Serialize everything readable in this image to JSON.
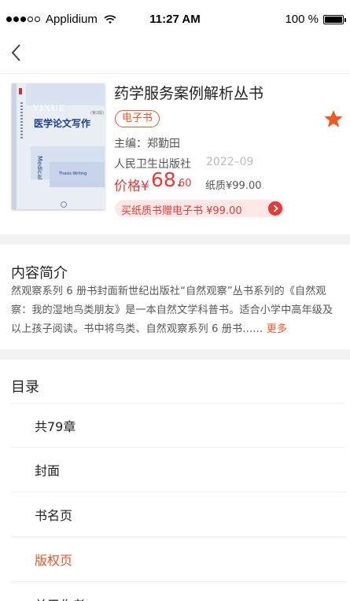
{
  "status_bar": {
    "carrier": "Applidium",
    "time": "11:27 AM",
    "battery": "100 %"
  },
  "nav": {
    "back_icon": "chevron-left-icon"
  },
  "book": {
    "cover": {
      "header_text": "YIXUE",
      "title": "医学论文写作",
      "edition": "(第2版)",
      "spine_text": "Medical",
      "subtitle": "Thesis Writing"
    },
    "title": "药学服务案例解析丛书",
    "badge": "电子书",
    "author": "主编：郑勤田",
    "publisher": "人民卫生出版社",
    "pub_date": "2022–09",
    "price_label": "价格¥",
    "price_integer": "68.",
    "price_decimal": "60",
    "paper_price": "纸质¥99.00",
    "promo": "买纸质书赠电子书 ¥99.00",
    "favorite_icon": "star-icon",
    "colors": {
      "accent": "#e8562b",
      "price": "#e03c3c"
    }
  },
  "intro": {
    "title": "内容简介",
    "body": "然观察系列 6 册书封面新世纪出版社“自然观察”丛书系列的《自然观察：我的湿地鸟类朋友》是一本自然文学科普书。适合小学中高年级及以上孩子阅读。书中将鸟类、自然观察系列 6 册书......",
    "more": "更多"
  },
  "toc": {
    "title": "目录",
    "items": [
      {
        "label": "共79章",
        "active": false
      },
      {
        "label": "封面",
        "active": false
      },
      {
        "label": "书名页",
        "active": false
      },
      {
        "label": "版权页",
        "active": true
      },
      {
        "label": "关于作者",
        "active": false
      }
    ]
  }
}
